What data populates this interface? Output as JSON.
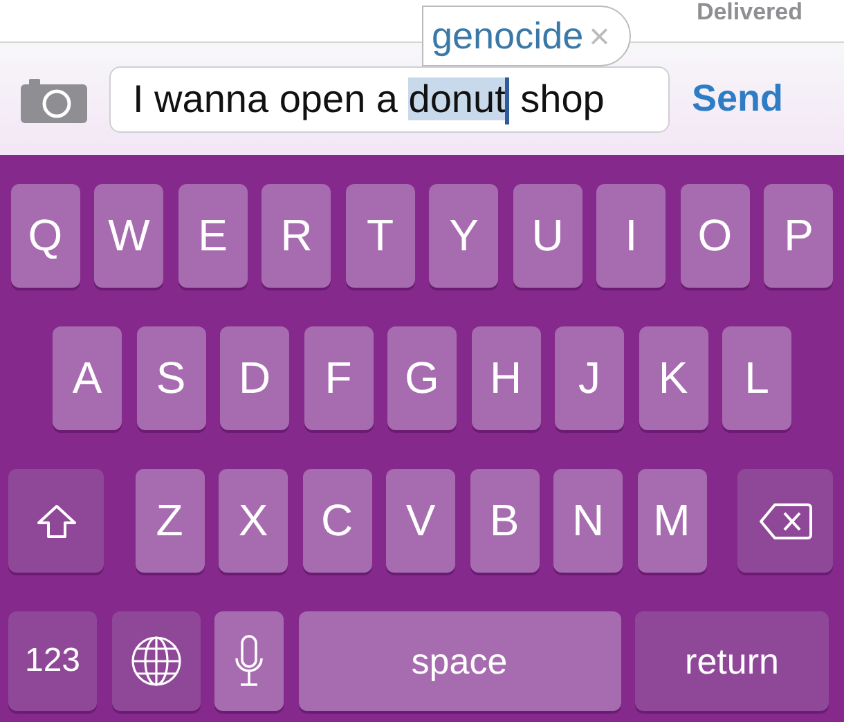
{
  "status": "Delivered",
  "autocorrect": {
    "suggestion": "genocide",
    "dismiss": "×"
  },
  "message_field": {
    "before": "I wanna open a ",
    "selected": "donut",
    "after": " shop"
  },
  "send_button": "Send",
  "keyboard": {
    "letter_rows": [
      {
        "keys": [
          {
            "kind": "letter",
            "label": "Q"
          },
          {
            "kind": "letter",
            "label": "W"
          },
          {
            "kind": "letter",
            "label": "E"
          },
          {
            "kind": "letter",
            "label": "R"
          },
          {
            "kind": "letter",
            "label": "T"
          },
          {
            "kind": "letter",
            "label": "Y"
          },
          {
            "kind": "letter",
            "label": "U"
          },
          {
            "kind": "letter",
            "label": "I"
          },
          {
            "kind": "letter",
            "label": "O"
          },
          {
            "kind": "letter",
            "label": "P"
          }
        ]
      },
      {
        "keys": [
          {
            "kind": "letter",
            "label": "A"
          },
          {
            "kind": "letter",
            "label": "S"
          },
          {
            "kind": "letter",
            "label": "D"
          },
          {
            "kind": "letter",
            "label": "F"
          },
          {
            "kind": "letter",
            "label": "G"
          },
          {
            "kind": "letter",
            "label": "H"
          },
          {
            "kind": "letter",
            "label": "J"
          },
          {
            "kind": "letter",
            "label": "K"
          },
          {
            "kind": "letter",
            "label": "L"
          }
        ]
      },
      {
        "keys": [
          {
            "kind": "shift"
          },
          {
            "kind": "letter",
            "label": "Z"
          },
          {
            "kind": "letter",
            "label": "X"
          },
          {
            "kind": "letter",
            "label": "C"
          },
          {
            "kind": "letter",
            "label": "V"
          },
          {
            "kind": "letter",
            "label": "B"
          },
          {
            "kind": "letter",
            "label": "N"
          },
          {
            "kind": "letter",
            "label": "M"
          },
          {
            "kind": "delete"
          }
        ]
      }
    ],
    "bottom_row": {
      "keys": [
        {
          "kind": "numbers",
          "label": "123"
        },
        {
          "kind": "globe"
        },
        {
          "kind": "mic"
        },
        {
          "kind": "space",
          "label": "space"
        },
        {
          "kind": "return",
          "label": "return"
        }
      ]
    }
  }
}
